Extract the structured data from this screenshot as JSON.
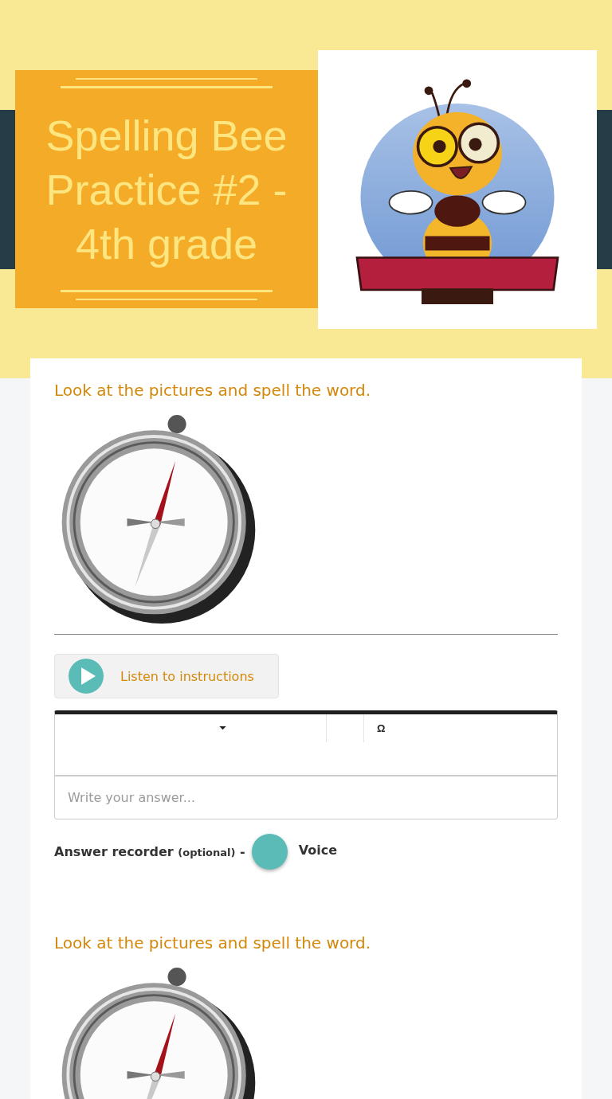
{
  "header": {
    "title": "Spelling Bee Practice #2 - 4th grade"
  },
  "questions": [
    {
      "prompt": "Look at the pictures and spell the word.",
      "listen_label": "Listen to instructions",
      "toolbar_symbol": "Ω",
      "answer_placeholder": "Write your answer...",
      "recorder": {
        "label": "Answer recorder",
        "note": "(optional)",
        "separator": "-",
        "voice_label": "Voice"
      }
    },
    {
      "prompt": "Look at the pictures and spell the word."
    }
  ]
}
